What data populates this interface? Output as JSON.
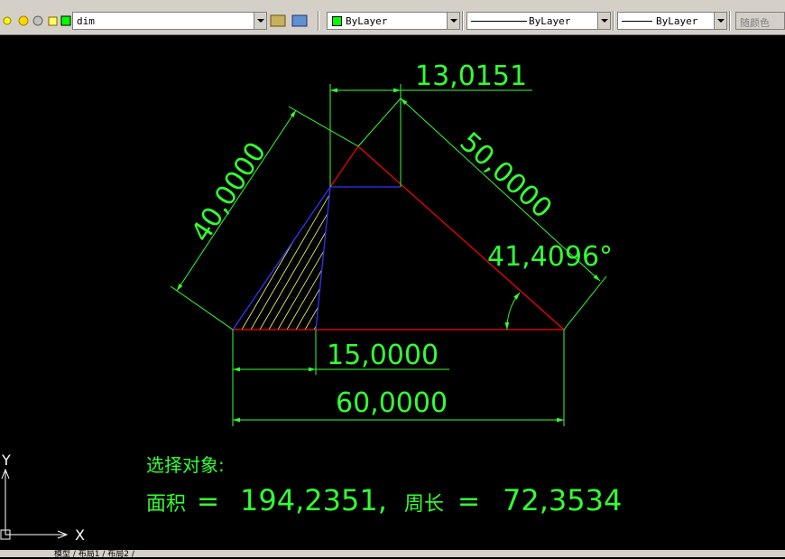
{
  "toolbar": {
    "layer_name": "dim",
    "color_label": "ByLayer",
    "linetype_label": "ByLayer",
    "lineweight_label": "ByLayer",
    "plotstyle_label": "随颜色"
  },
  "drawing": {
    "dim_top": "13,0151",
    "dim_left": "40,0000",
    "dim_right": "50,0000",
    "dim_angle": "41,4096°",
    "dim_inner": "15,0000",
    "dim_base": "60,0000"
  },
  "ucs": {
    "y_label": "Y",
    "x_label": "X"
  },
  "command": {
    "line1": "选择对象:",
    "line2_label": "面积",
    "line2_eq1": "=",
    "line2_area": "194,2351,",
    "line2_perim_label": "周长",
    "line2_eq2": "=",
    "line2_perim": "72,3534"
  },
  "statusbar": {
    "tabs": "模型 / 布局1 / 布局2 /"
  },
  "colors": {
    "dim_green": "#33ff33",
    "outline_red": "#ff0000",
    "outline_blue": "#3333ff",
    "hatch": "#ffff66",
    "background": "#000000"
  }
}
